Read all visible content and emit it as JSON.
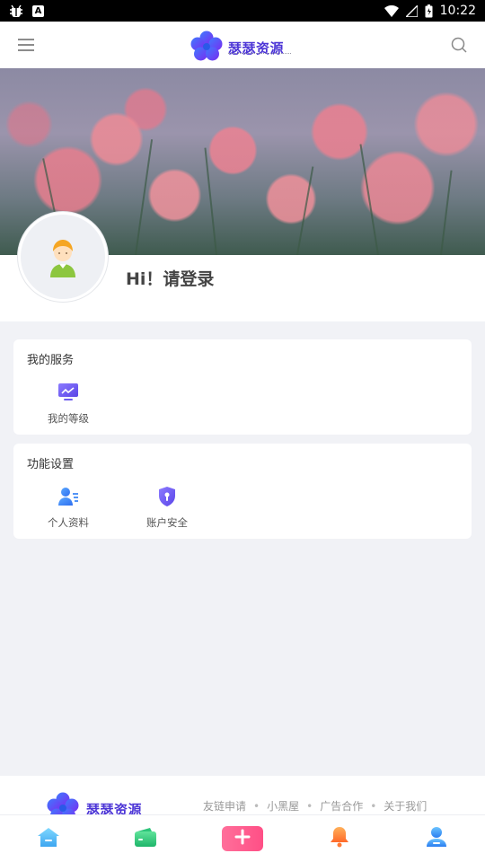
{
  "status_bar": {
    "time": "10:22",
    "notif_letter": "A"
  },
  "top_bar": {
    "logo_text": "瑟瑟资源"
  },
  "profile": {
    "login_prompt": "Hi！请登录"
  },
  "services": {
    "title": "我的服务",
    "items": [
      {
        "label": "我的等级",
        "icon": "chart-monitor-icon"
      }
    ]
  },
  "settings": {
    "title": "功能设置",
    "items": [
      {
        "label": "个人资料",
        "icon": "profile-card-icon"
      },
      {
        "label": "账户安全",
        "icon": "shield-lock-icon"
      }
    ]
  },
  "footer": {
    "logo_text": "瑟瑟资源",
    "links": [
      "友链申请",
      "小黑屋",
      "广告合作",
      "关于我们"
    ]
  },
  "tab_bar": {
    "items": [
      "home-icon",
      "wallet-icon",
      "plus-icon",
      "bell-icon",
      "user-icon"
    ]
  },
  "colors": {
    "accent": "#4b34d6",
    "tab_plus": "#ff4f86",
    "page_bg": "#f1f2f6"
  }
}
